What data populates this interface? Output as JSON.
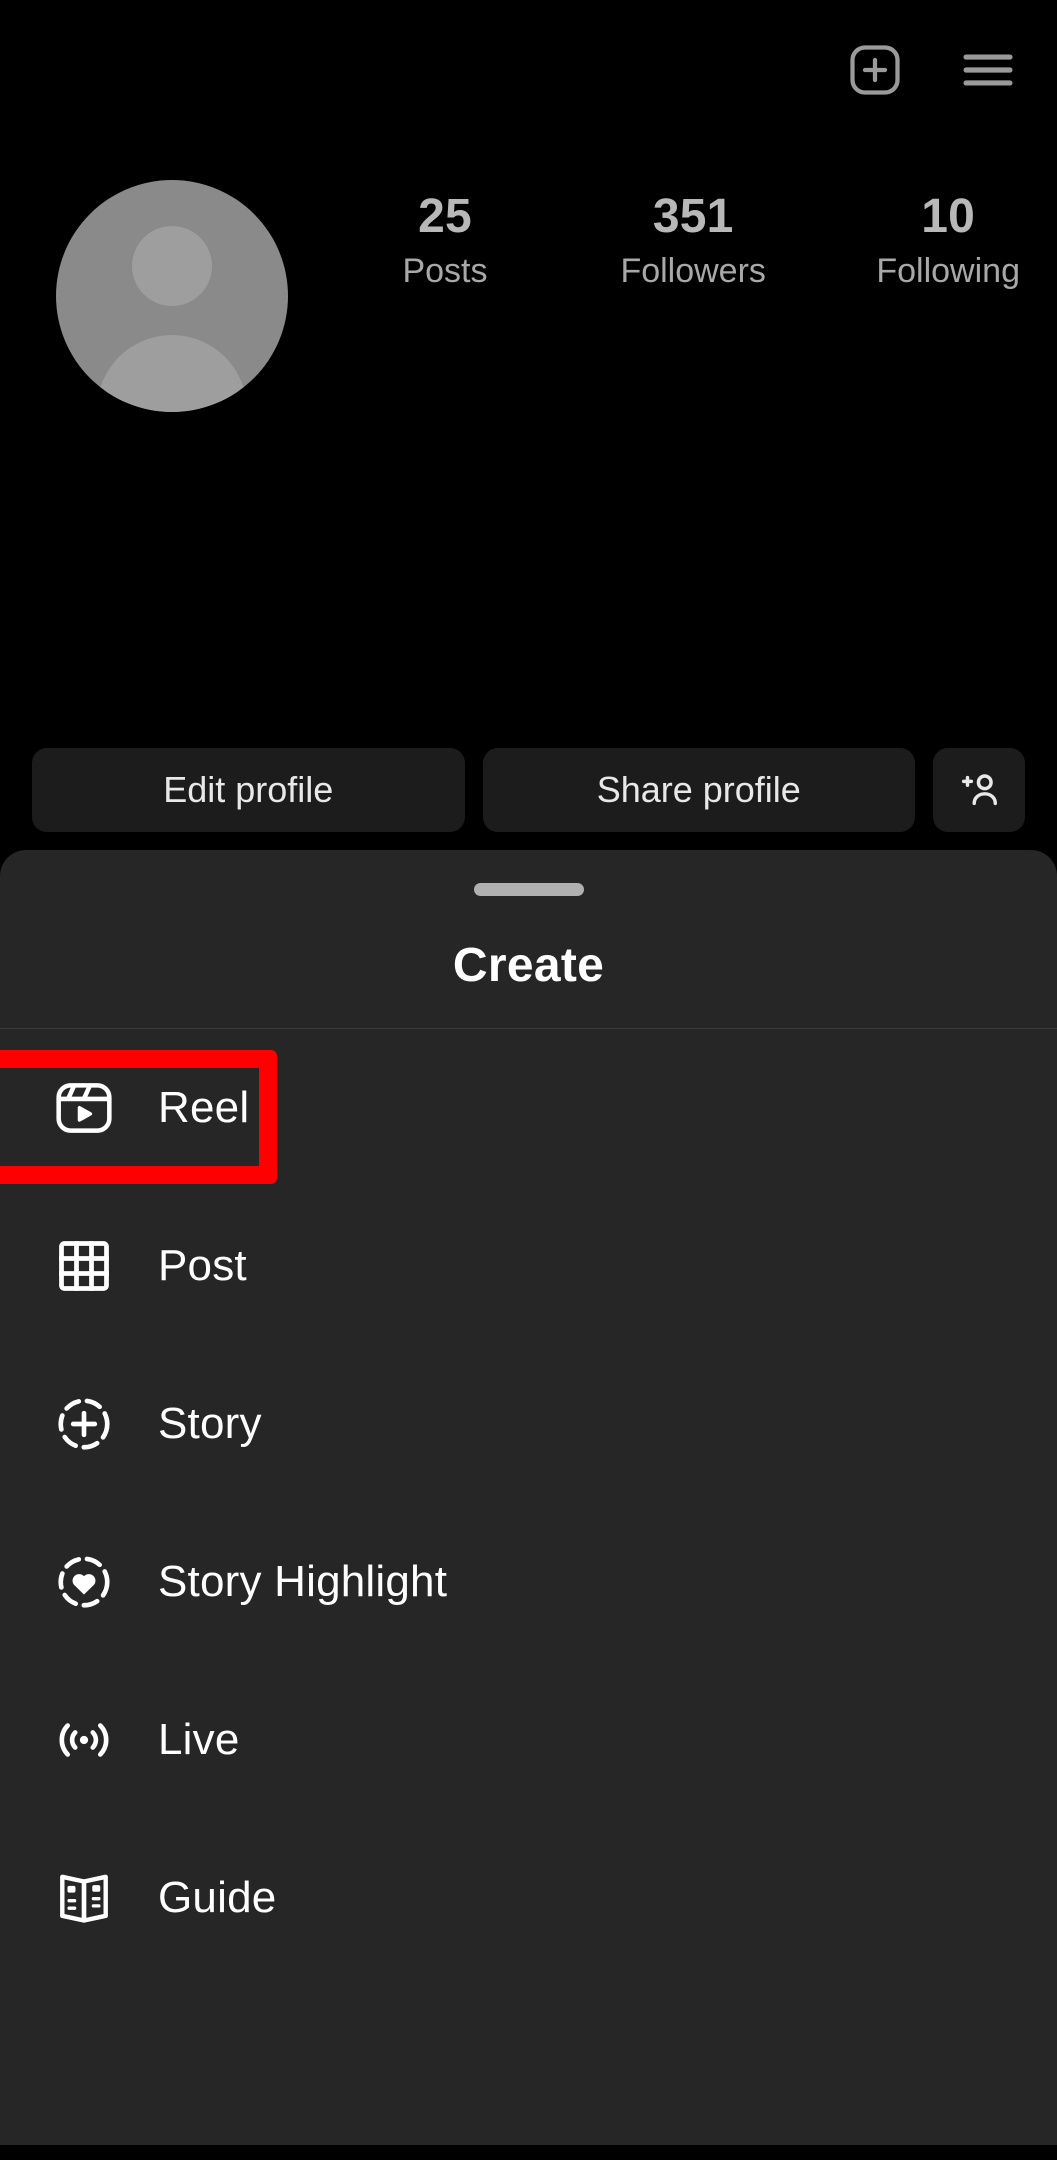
{
  "app": "Instagram Profile",
  "header": {
    "create_icon": "plus-square-icon",
    "menu_icon": "hamburger-menu-icon"
  },
  "profile": {
    "avatar_icon": "default-avatar-icon",
    "stats": [
      {
        "value": "25",
        "label": "Posts"
      },
      {
        "value": "351",
        "label": "Followers"
      },
      {
        "value": "10",
        "label": "Following"
      }
    ]
  },
  "actions": {
    "edit_profile": "Edit profile",
    "share_profile": "Share profile",
    "add_person_icon": "add-person-icon"
  },
  "sheet": {
    "title": "Create",
    "handle": "drag-handle",
    "items": [
      {
        "label": "Reel",
        "icon": "reel-icon",
        "highlighted": true
      },
      {
        "label": "Post",
        "icon": "grid-post-icon",
        "highlighted": false
      },
      {
        "label": "Story",
        "icon": "story-plus-icon",
        "highlighted": false
      },
      {
        "label": "Story Highlight",
        "icon": "story-heart-icon",
        "highlighted": false
      },
      {
        "label": "Live",
        "icon": "live-broadcast-icon",
        "highlighted": false
      },
      {
        "label": "Guide",
        "icon": "guide-book-icon",
        "highlighted": false
      }
    ]
  },
  "colors": {
    "background": "#000000",
    "sheet_background": "#262626",
    "button_background": "#1c1c1c",
    "text_primary": "#ffffff",
    "text_secondary": "#b8b8b8",
    "highlight": "#FF0000"
  }
}
